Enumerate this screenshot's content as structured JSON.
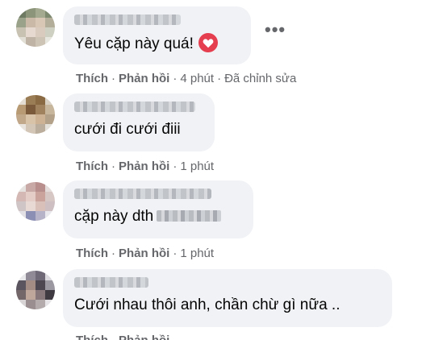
{
  "comments": [
    {
      "text": "Yêu cặp này quá!",
      "like": "Thích",
      "reply": "Phản hồi",
      "sep": "·",
      "time": "4 phút",
      "edited": "Đã chỉnh sửa",
      "icon": "heart-icon"
    },
    {
      "text": "cưới đi cưới điii",
      "like": "Thích",
      "reply": "Phản hồi",
      "sep": "·",
      "time": "1 phút"
    },
    {
      "text": "cặp này dth",
      "like": "Thích",
      "reply": "Phản hồi",
      "sep": "·",
      "time": "1 phút"
    },
    {
      "text": "Cưới nhau thôi anh, chần chừ gì nữa ..",
      "like": "Thích",
      "reply": "Phản hồi",
      "sep": "·",
      "time": ""
    }
  ],
  "more_menu": "•••",
  "colors": {
    "bubble": "#f0f2f5",
    "meta": "#65676b",
    "heart": "#e53e4f"
  }
}
